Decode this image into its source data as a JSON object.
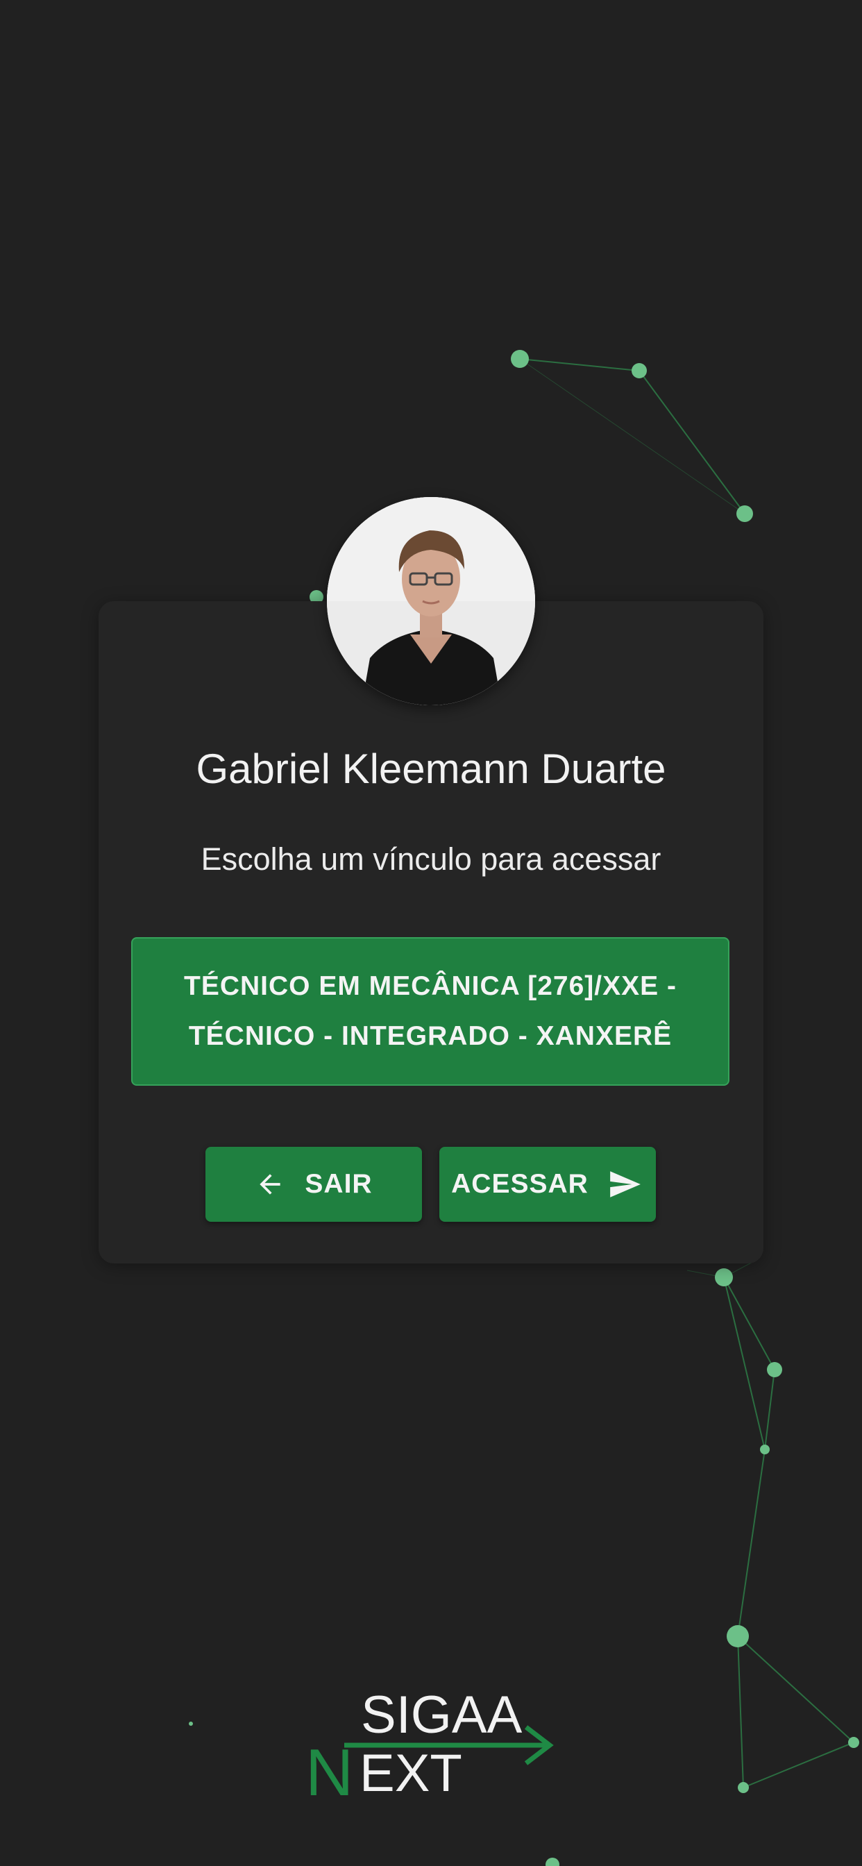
{
  "user": {
    "name": "Gabriel Kleemann Duarte"
  },
  "prompt": "Escolha um vínculo para acessar",
  "link_option": {
    "label": "TÉCNICO EM MECÂNICA [276]/XXE - TÉCNICO - INTEGRADO - XANXERÊ",
    "selected": true
  },
  "buttons": {
    "exit": {
      "label": "SAIR",
      "icon": "arrow-left-icon"
    },
    "access": {
      "label": "ACESSAR",
      "icon": "send-icon"
    }
  },
  "logo": {
    "top_text": "SIGAA",
    "letter_n": "N",
    "bottom_text": "EXT"
  },
  "colors": {
    "background": "#212121",
    "card": "#252525",
    "accent_green": "#1f8040",
    "network_green": "#6cc088"
  }
}
